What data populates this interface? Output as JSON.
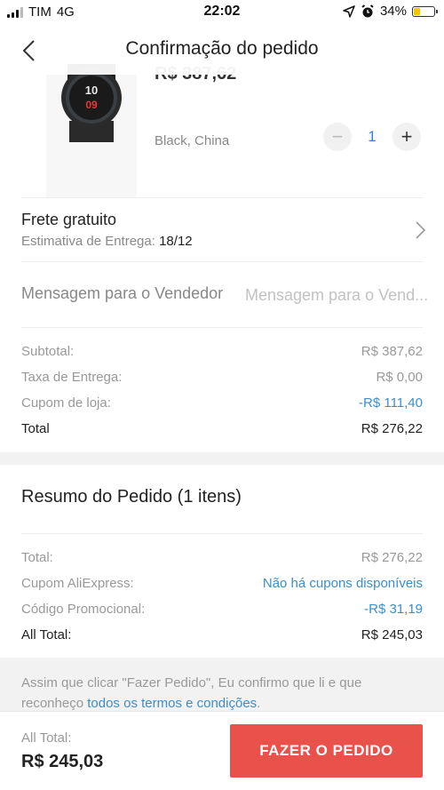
{
  "status_bar": {
    "carrier": "TIM",
    "network": "4G",
    "time": "22:02",
    "battery_percent": "34%",
    "battery_level": 0.34,
    "icons": [
      "signal-icon",
      "location-arrow-icon",
      "alarm-clock-icon",
      "battery-icon"
    ]
  },
  "header": {
    "title": "Confirmação do pedido",
    "back_icon": "chevron-left-icon"
  },
  "product": {
    "price": "R$ 387,62",
    "variant": "Black, China",
    "quantity": "1",
    "decrement_icon": "minus-icon",
    "increment_icon": "plus-icon"
  },
  "shipping": {
    "title": "Frete gratuito",
    "estimate_label": "Estimativa de Entrega:",
    "estimate_date": "18/12",
    "chevron_icon": "chevron-right-icon"
  },
  "message": {
    "label": "Mensagem para o Vendedor",
    "placeholder": "Mensagem para o Vend..."
  },
  "costs": {
    "subtotal_label": "Subtotal:",
    "subtotal_value": "R$ 387,62",
    "shipping_label": "Taxa de Entrega:",
    "shipping_value": "R$ 0,00",
    "store_coupon_label": "Cupom de loja:",
    "store_coupon_value": "-R$ 111,40",
    "total_label": "Total",
    "total_value": "R$ 276,22"
  },
  "summary": {
    "title": "Resumo do Pedido (1 itens)",
    "total_label": "Total:",
    "total_value": "R$ 276,22",
    "aliexpress_coupon_label": "Cupom AliExpress:",
    "aliexpress_coupon_value": "Não há cupons disponíveis",
    "promo_code_label": "Código Promocional:",
    "promo_code_value": "-R$ 31,19",
    "all_total_label": "All Total:",
    "all_total_value": "R$ 245,03"
  },
  "notice": {
    "text": "Assim que clicar \"Fazer Pedido\", Eu confirmo que li e que reconheço",
    "link": "todos os termos e condições",
    "end": "."
  },
  "footer": {
    "all_total_label": "All Total:",
    "all_total_value": "R$ 245,03",
    "order_button": "FAZER O PEDIDO"
  },
  "colors": {
    "accent_red": "#e9524a",
    "link_blue": "#3d8ec9",
    "quantity_blue": "#3d7ed6",
    "battery_yellow": "#f5c400"
  }
}
